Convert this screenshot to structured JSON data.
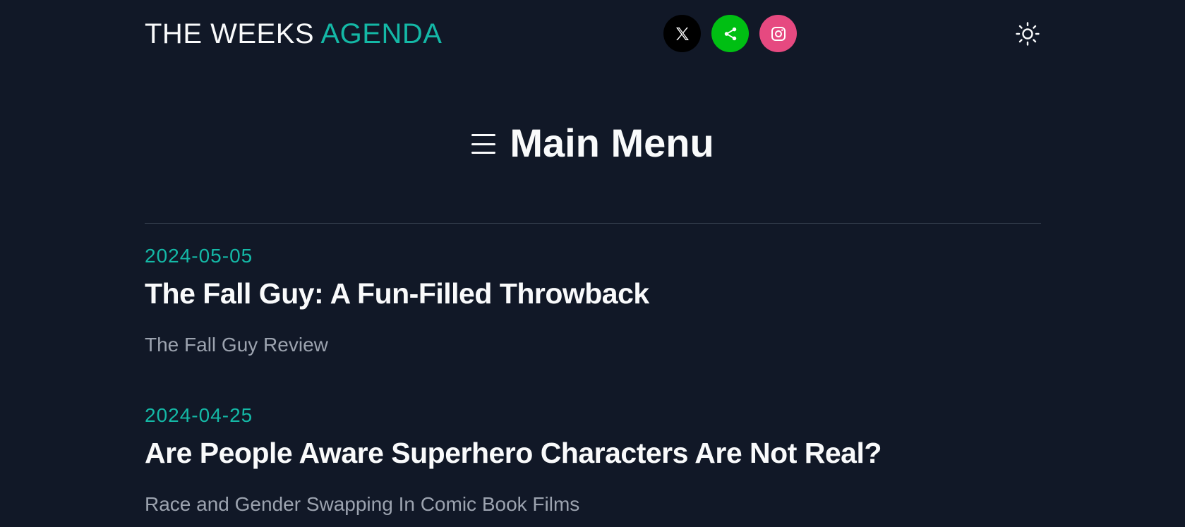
{
  "header": {
    "brand_main": "THE WEEKS ",
    "brand_accent": "AGENDA",
    "socials": [
      {
        "name": "x-twitter",
        "icon": "x-logo-icon",
        "color": "#000000"
      },
      {
        "name": "share",
        "icon": "share-icon",
        "color": "#00bf13"
      },
      {
        "name": "instagram",
        "icon": "instagram-icon",
        "color": "#e64980"
      }
    ],
    "theme_toggle_icon": "sun-icon"
  },
  "menu": {
    "icon": "hamburger-icon",
    "title": "Main Menu"
  },
  "posts": [
    {
      "date": "2024-05-05",
      "title": "The Fall Guy: A Fun-Filled Throwback",
      "summary": "The Fall Guy Review"
    },
    {
      "date": "2024-04-25",
      "title": "Are People Aware Superhero Characters Are Not Real?",
      "summary": "Race and Gender Swapping In Comic Book Films"
    }
  ],
  "colors": {
    "background": "#111827",
    "accent": "#14b8a6",
    "text": "#f9fafb",
    "muted": "#9ca3af"
  }
}
